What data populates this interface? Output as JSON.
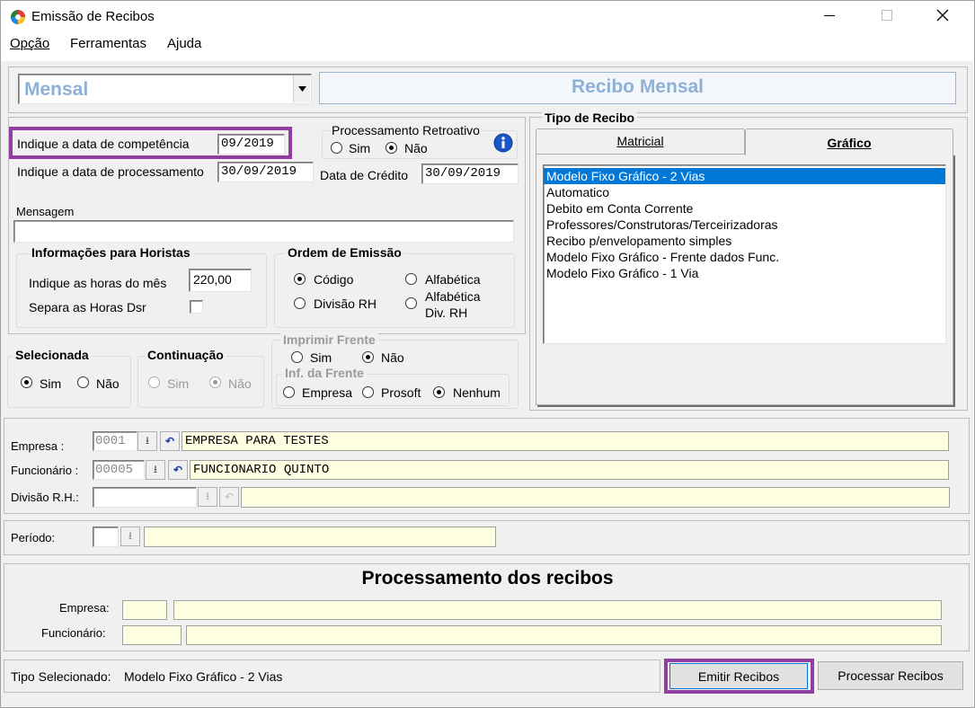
{
  "window": {
    "title": "Emissão de Recibos",
    "menu": [
      {
        "label": "Opção",
        "key": "O"
      },
      {
        "label": "Ferramentas",
        "key": "F"
      },
      {
        "label": "Ajuda",
        "key": "A"
      }
    ]
  },
  "header": {
    "period_type": "Mensal",
    "receipt_title": "Recibo Mensal"
  },
  "dates": {
    "competencia_label": "Indique a data de competência",
    "competencia_value": "09/2019",
    "processamento_label": "Indique a data de processamento",
    "processamento_value": "30/09/2019",
    "credito_label": "Data de Crédito",
    "credito_value": "30/09/2019"
  },
  "retroativo": {
    "title": "Processamento Retroativo",
    "sim": "Sim",
    "nao": "Não",
    "selected": "Não"
  },
  "mensagem": {
    "label": "Mensagem",
    "value": ""
  },
  "horistas": {
    "title": "Informações para Horistas",
    "horas_label": "Indique as horas do mês",
    "horas_value": "220,00",
    "separa_label": "Separa as Horas Dsr"
  },
  "ordem": {
    "title": "Ordem de Emissão",
    "codigo": "Código",
    "alfabetica": "Alfabética",
    "divisao": "Divisão RH",
    "alfabetica_div_1": "Alfabética",
    "alfabetica_div_2": "Div.  RH",
    "selected": "Código"
  },
  "selecionada": {
    "title": "Selecionada",
    "sim": "Sim",
    "nao": "Não"
  },
  "continuacao": {
    "title": "Continuação",
    "sim": "Sim",
    "nao": "Não"
  },
  "imprimir_frente": {
    "title": "Imprimir Frente",
    "sim": "Sim",
    "nao": "Não",
    "inf_title": "Inf. da Frente",
    "empresa": "Empresa",
    "prosoft": "Prosoft",
    "nenhum": "Nenhum"
  },
  "tipo_recibo": {
    "title": "Tipo de Recibo",
    "tabs": [
      "Matricial",
      "Gráfico"
    ],
    "items": [
      "Modelo Fixo Gráfico - 2 Vias",
      "Automatico",
      "Debito em Conta Corrente",
      "Professores/Construtoras/Terceirizadoras",
      "Recibo p/envelopamento simples",
      "Modelo Fixo Gráfico - Frente dados Func.",
      "Modelo Fixo Gráfico - 1 Via"
    ],
    "selected_index": 0
  },
  "filters": {
    "empresa_label": "Empresa :",
    "empresa_code": "0001",
    "empresa_name": "EMPRESA PARA TESTES",
    "funcionario_label": "Funcionário :",
    "funcionario_code": "00005",
    "funcionario_name": "FUNCIONARIO QUINTO",
    "divisao_label": "Divisão R.H.:",
    "divisao_code": "",
    "divisao_name": "",
    "periodo_label": "Período:",
    "periodo_code": "",
    "periodo_name": ""
  },
  "processamento": {
    "title": "Processamento dos recibos",
    "empresa_label": "Empresa:",
    "funcionario_label": "Funcionário:"
  },
  "status": {
    "tipo_label": "Tipo Selecionado:",
    "tipo_value": "Modelo Fixo Gráfico - 2 Vias"
  },
  "buttons": {
    "emitir": "Emitir Recibos",
    "processar": "Processar Recibos"
  },
  "colors": {
    "highlight": "#8e3fa0",
    "selection": "#0078d7",
    "field_yellow": "#ffffe1",
    "period_text": "#8fb0d6"
  }
}
